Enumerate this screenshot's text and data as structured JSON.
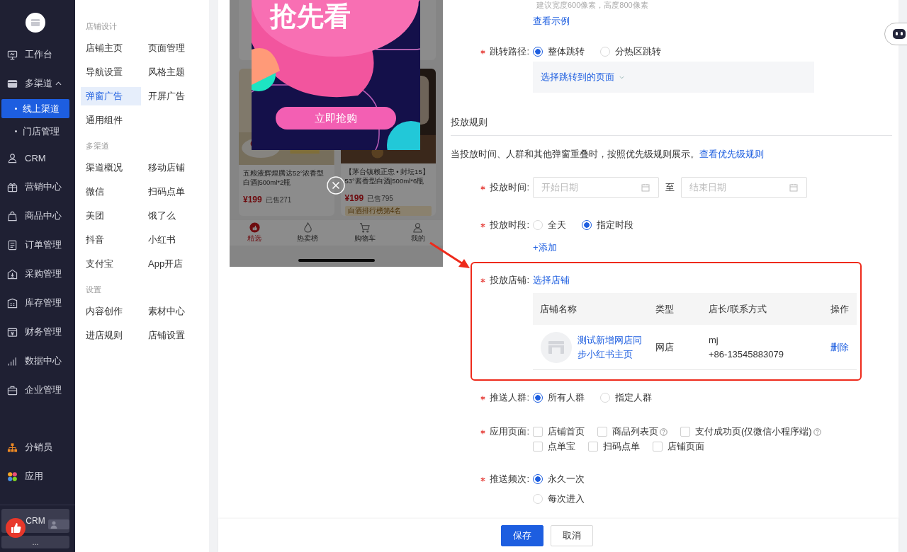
{
  "sidebar": {
    "items": [
      {
        "label": "工作台",
        "selected": false
      },
      {
        "label": "多渠道",
        "selected": false,
        "expanded": true,
        "children": [
          {
            "label": "线上渠道",
            "selected": true
          },
          {
            "label": "门店管理",
            "selected": false
          }
        ]
      },
      {
        "label": "CRM",
        "selected": false
      },
      {
        "label": "营销中心",
        "selected": false
      },
      {
        "label": "商品中心",
        "selected": false
      },
      {
        "label": "订单管理",
        "selected": false
      },
      {
        "label": "采购管理",
        "selected": false
      },
      {
        "label": "库存管理",
        "selected": false
      },
      {
        "label": "财务管理",
        "selected": false
      },
      {
        "label": "数据中心",
        "selected": false
      },
      {
        "label": "企业管理",
        "selected": false
      }
    ],
    "bottom_items": [
      {
        "label": "分销员"
      },
      {
        "label": "应用"
      }
    ],
    "footer": {
      "label": "CRM",
      "more": "..."
    }
  },
  "subnav": {
    "groups": [
      {
        "title": "店铺设计",
        "items": [
          {
            "label": "店铺主页",
            "selected": false
          },
          {
            "label": "页面管理",
            "selected": false
          },
          {
            "label": "导航设置",
            "selected": false
          },
          {
            "label": "风格主题",
            "selected": false
          },
          {
            "label": "弹窗广告",
            "selected": true
          },
          {
            "label": "开屏广告",
            "selected": false
          },
          {
            "label": "通用组件",
            "selected": false
          }
        ]
      },
      {
        "title": "多渠道",
        "items": [
          {
            "label": "渠道概况",
            "selected": false
          },
          {
            "label": "移动店铺",
            "selected": false
          },
          {
            "label": "微信",
            "selected": false
          },
          {
            "label": "扫码点单",
            "selected": false
          },
          {
            "label": "美团",
            "selected": false
          },
          {
            "label": "饿了么",
            "selected": false
          },
          {
            "label": "抖音",
            "selected": false
          },
          {
            "label": "小红书",
            "selected": false
          },
          {
            "label": "支付宝",
            "selected": false
          },
          {
            "label": "App开店",
            "selected": false
          }
        ]
      },
      {
        "title": "设置",
        "items": [
          {
            "label": "内容创作",
            "selected": false
          },
          {
            "label": "素材中心",
            "selected": false
          },
          {
            "label": "进店规则",
            "selected": false
          },
          {
            "label": "店铺设置",
            "selected": false
          }
        ]
      }
    ]
  },
  "preview": {
    "banner_title": "抢先看",
    "banner_button": "立即抢购",
    "products": [
      {
        "name": "五粮液辉煌腾达52°浓香型白酒|500ml*2瓶",
        "price": "¥199",
        "sold": "已售271"
      },
      {
        "name": "【茅台镇赖正忠 • 封坛15】53°酱香型白酒|500ml*6瓶",
        "price": "¥199",
        "sold": "已售795",
        "rank": "白酒排行榜第4名"
      }
    ],
    "tabs": [
      {
        "label": "精选",
        "selected": true
      },
      {
        "label": "热卖榜",
        "selected": false
      },
      {
        "label": "购物车",
        "selected": false
      },
      {
        "label": "我的",
        "selected": false
      }
    ]
  },
  "form": {
    "hint": "建议宽度600像素，高度800像素",
    "example_link": "查看示例",
    "jump": {
      "label": "跳转路径:",
      "required": true,
      "options": [
        {
          "label": "整体跳转",
          "selected": true
        },
        {
          "label": "分热区跳转",
          "selected": false
        }
      ],
      "page_select": "选择跳转到的页面"
    },
    "section_title": "投放规则",
    "notice": {
      "text": "当投放时间、人群和其他弹窗重叠时，按照优先级规则展示。",
      "link": "查看优先级规则"
    },
    "time": {
      "label": "投放时间:",
      "required": true,
      "start_placeholder": "开始日期",
      "separator": "至",
      "end_placeholder": "结束日期"
    },
    "period": {
      "label": "投放时段:",
      "required": true,
      "options": [
        {
          "label": "全天",
          "selected": false
        },
        {
          "label": "指定时段",
          "selected": true
        }
      ],
      "add": "+添加"
    },
    "stores": {
      "label": "投放店铺:",
      "required": true,
      "highlighted": true,
      "select_link": "选择店铺",
      "columns": [
        "店铺名称",
        "类型",
        "店长/联系方式",
        "操作"
      ],
      "rows": [
        {
          "name": "测试新增网店同步小红书主页",
          "type": "网店",
          "manager": "mj",
          "phone": "+86-13545883079",
          "action": "删除"
        }
      ]
    },
    "audience": {
      "label": "推送人群:",
      "required": true,
      "options": [
        {
          "label": "所有人群",
          "selected": true
        },
        {
          "label": "指定人群",
          "selected": false
        }
      ]
    },
    "pages": {
      "label": "应用页面:",
      "required": true,
      "options": [
        {
          "label": "店铺首页",
          "checked": false,
          "help": false
        },
        {
          "label": "商品列表页",
          "checked": false,
          "help": true
        },
        {
          "label": "支付成功页(仅微信小程序端)",
          "checked": false,
          "help": true
        },
        {
          "label": "点单宝",
          "checked": false,
          "help": false
        },
        {
          "label": "扫码点单",
          "checked": false,
          "help": false
        },
        {
          "label": "店铺页面",
          "checked": false,
          "help": false
        }
      ]
    },
    "frequency": {
      "label": "推送频次:",
      "required": true,
      "options": [
        {
          "label": "永久一次",
          "selected": true
        },
        {
          "label": "每次进入",
          "selected": false
        }
      ]
    }
  },
  "footer": {
    "save": "保存",
    "cancel": "取消"
  }
}
